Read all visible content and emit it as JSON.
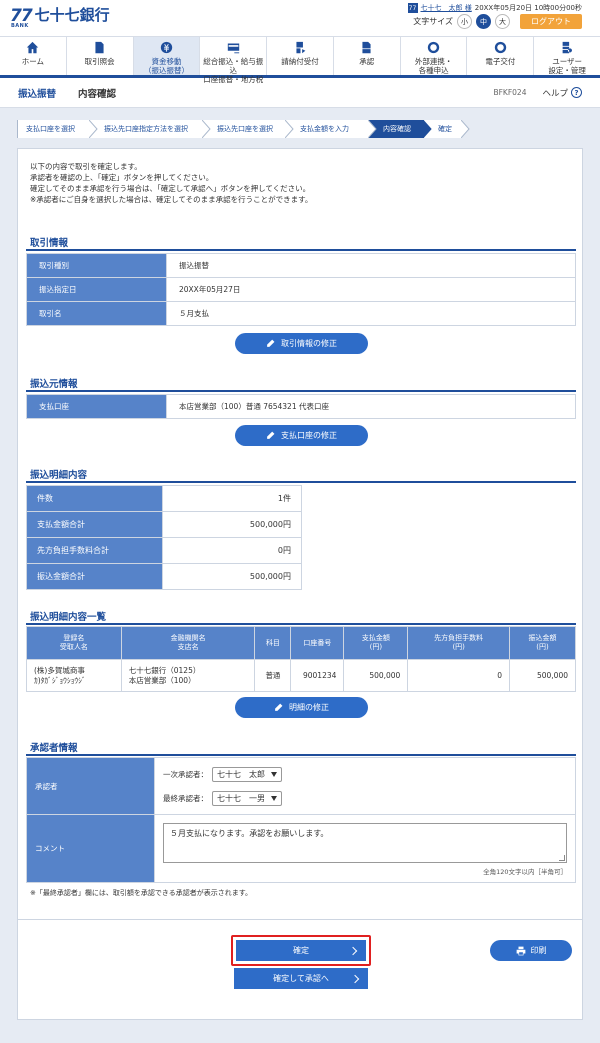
{
  "header": {
    "logo_mark": "77",
    "logo_bank": "BANK",
    "logo_name": "七十七銀行",
    "user_icon": "77",
    "user_name": "七十七　太郎 様",
    "login_time": "20XX年05月20日 10時00分00秒",
    "font_size_label": "文字サイズ",
    "font_sizes": [
      "小",
      "中",
      "大"
    ],
    "logout": "ログアウト"
  },
  "nav": [
    {
      "icon": "home-icon",
      "l1": "ホーム",
      "l2": ""
    },
    {
      "icon": "document-icon",
      "l1": "取引照会",
      "l2": ""
    },
    {
      "icon": "yen-icon",
      "l1": "資金移動",
      "l2": "（振込振替）"
    },
    {
      "icon": "card-icon",
      "l1": "総合振込・給与振込",
      "l2": "口座振替・地方税"
    },
    {
      "icon": "bill-icon",
      "l1": "請納付受付",
      "l2": ""
    },
    {
      "icon": "approve-icon",
      "l1": "承認",
      "l2": ""
    },
    {
      "icon": "link-icon",
      "l1": "外部連携・",
      "l2": "各種申込"
    },
    {
      "icon": "exchange-icon",
      "l1": "電子交付",
      "l2": ""
    },
    {
      "icon": "user-settings-icon",
      "l1": "ユーザー",
      "l2": "設定・管理"
    }
  ],
  "titlebar": {
    "main": "振込振替",
    "sub": "内容確認",
    "code": "BFKF024",
    "help": "ヘルプ"
  },
  "steps": [
    "支払口座を選択",
    "振込先口座指定方法を選択",
    "振込先口座を選択",
    "支払金額を入力",
    "内容確認",
    "確定"
  ],
  "intro": [
    "以下の内容で取引を確定します。",
    "承認者を確認の上、「確定」ボタンを押してください。",
    "確定してそのまま承認を行う場合は、「確定して承認へ」ボタンを押してください。",
    "※承認者にご自身を選択した場合は、確定してそのまま承認を行うことができます。"
  ],
  "trade": {
    "title": "取引情報",
    "rows": [
      {
        "k": "取引種別",
        "v": "振込振替"
      },
      {
        "k": "振込指定日",
        "v": "20XX年05月27日"
      },
      {
        "k": "取引名",
        "v": "５月支払"
      }
    ],
    "edit": "取引情報の修正"
  },
  "source": {
    "title": "振込元情報",
    "rows": [
      {
        "k": "支払口座",
        "v": "本店営業部（100）普通 7654321 代表口座"
      }
    ],
    "edit": "支払口座の修正"
  },
  "summary": {
    "title": "振込明細内容",
    "rows": [
      {
        "k": "件数",
        "v": "1件"
      },
      {
        "k": "支払金額合計",
        "v": "500,000円"
      },
      {
        "k": "先方負担手数料合計",
        "v": "0円"
      },
      {
        "k": "振込金額合計",
        "v": "500,000円"
      }
    ]
  },
  "detail": {
    "title": "振込明細内容一覧",
    "headers": [
      [
        "登録名",
        "受取人名"
      ],
      [
        "金融機関名",
        "支店名"
      ],
      [
        "科目"
      ],
      [
        "口座番号"
      ],
      [
        "支払金額",
        "(円)"
      ],
      [
        "先方負担手数料",
        "(円)"
      ],
      [
        "振込金額",
        "(円)"
      ]
    ],
    "row": {
      "name1": "(株)多賀城商事",
      "name2": "ｶ)ﾀｶﾞｼﾞｮｳｼｮｳｼﾞ",
      "bank1": "七十七銀行（0125）",
      "bank2": "本店営業部（100）",
      "type": "普通",
      "account": "9001234",
      "pay": "500,000",
      "fee": "0",
      "amount": "500,000"
    },
    "edit": "明細の修正"
  },
  "approver": {
    "title": "承認者情報",
    "label": "承認者",
    "first_label": "一次承認者：",
    "first_value": "七十七　太郎",
    "final_label": "最終承認者：",
    "final_value": "七十七　一男",
    "comment_label": "コメント",
    "comment": "５月支払になります。承認をお願いします。",
    "limit": "全角120文字以内［半角可］",
    "note": "※「最終承認者」欄には、取引額を承認できる承認者が表示されます。"
  },
  "buttons": {
    "confirm": "確定",
    "confirm_approve": "確定して承認へ",
    "print": "印刷"
  }
}
